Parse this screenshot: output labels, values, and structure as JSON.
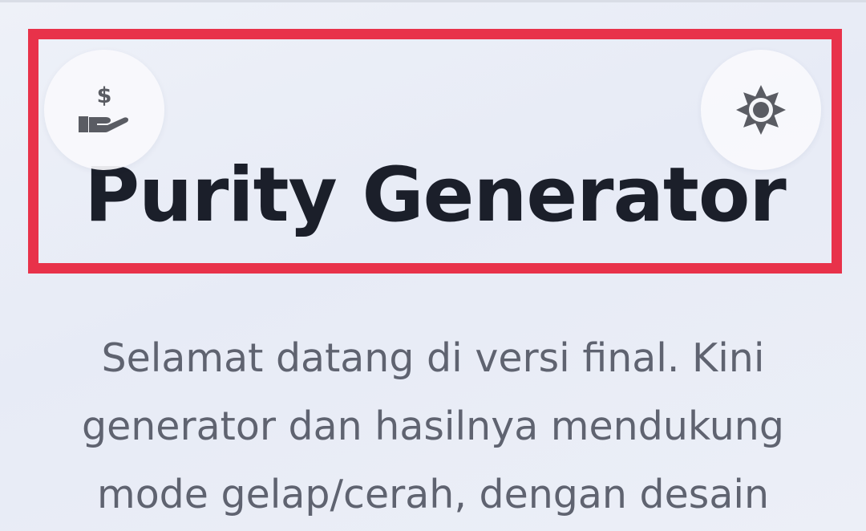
{
  "header": {
    "title": "Purity Generator",
    "donate_icon": "hand-holding-dollar-icon",
    "theme_icon": "sun-gear-icon"
  },
  "intro": {
    "text": "Selamat datang di versi final. Kini generator dan hasilnya mendukung mode gelap/cerah, dengan desain"
  },
  "colors": {
    "highlight": "#e8324a",
    "title": "#1b1f2a",
    "body_text": "#5f6370",
    "icon": "#5a5c63"
  }
}
